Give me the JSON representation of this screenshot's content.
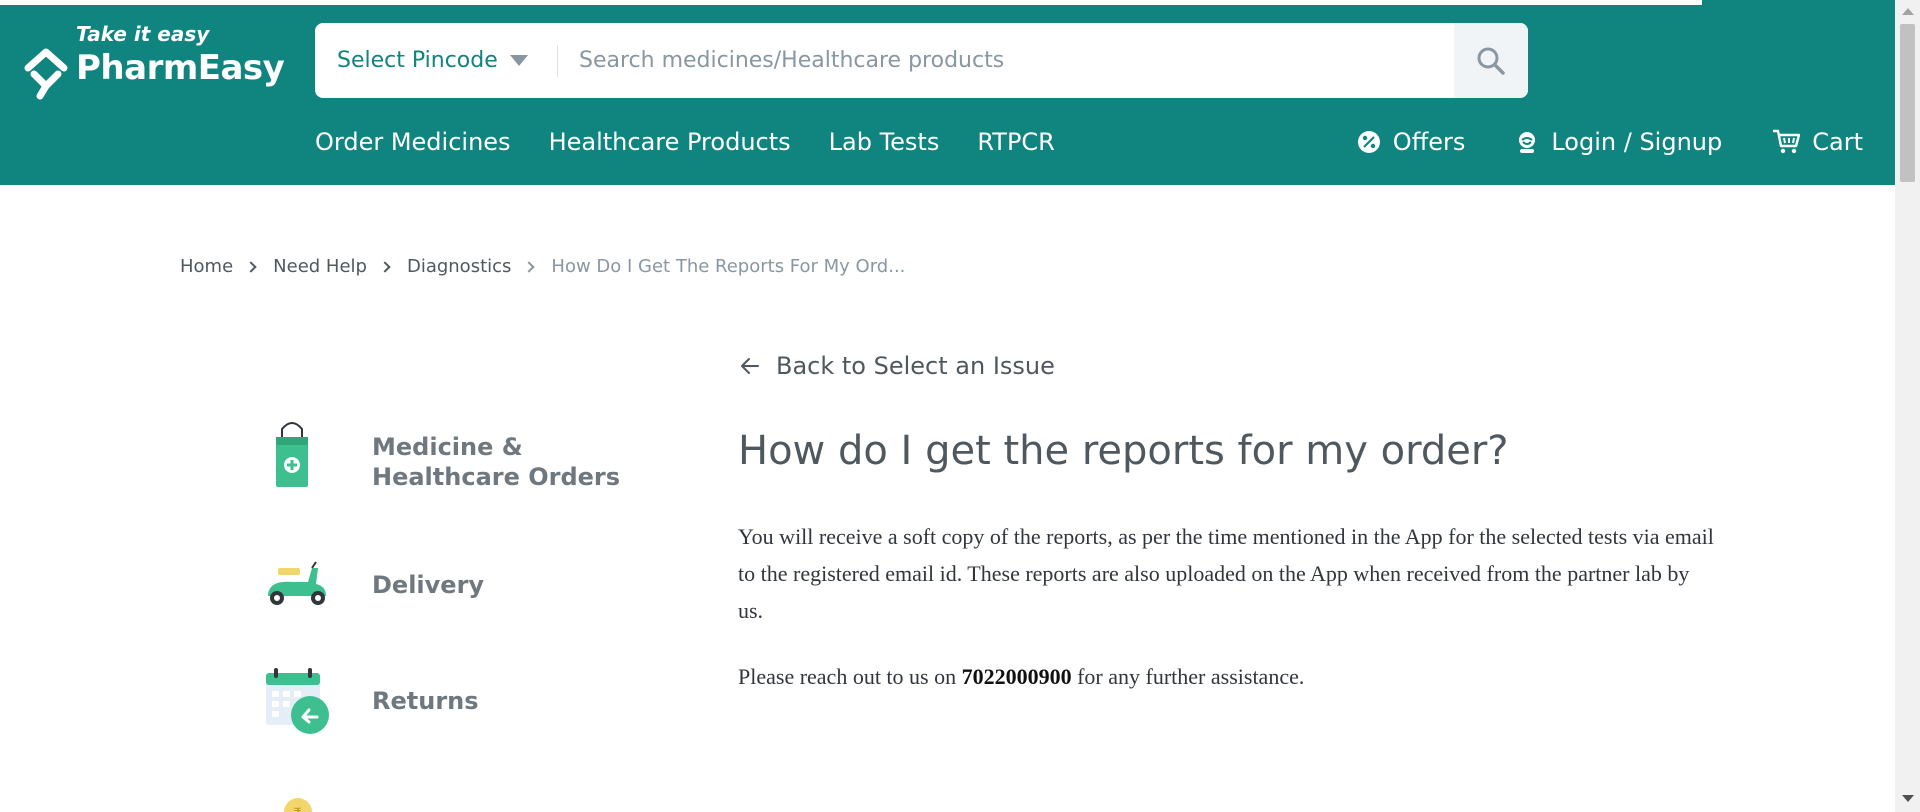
{
  "header": {
    "tagline": "Take it easy",
    "brand": "PharmEasy",
    "pincode_label": "Select Pincode",
    "search_placeholder": "Search medicines/Healthcare products",
    "nav": [
      "Order Medicines",
      "Healthcare Products",
      "Lab Tests",
      "RTPCR"
    ],
    "right_nav": {
      "offers": "Offers",
      "login": "Login / Signup",
      "cart": "Cart"
    }
  },
  "breadcrumb": {
    "home": "Home",
    "need_help": "Need Help",
    "diagnostics": "Diagnostics",
    "current": "How Do I Get The Reports For My Ord..."
  },
  "sidebar": {
    "items": [
      {
        "line1": "Medicine &",
        "line2": "Healthcare Orders",
        "icon": "shopping-bag-icon"
      },
      {
        "label": "Delivery",
        "icon": "scooter-icon"
      },
      {
        "label": "Returns",
        "icon": "calendar-return-icon"
      }
    ]
  },
  "content": {
    "back_link": "Back to Select an Issue",
    "title": "How do I get the reports for my order?",
    "body": "You will receive a soft copy of the reports, as per the time mentioned in the App for the selected tests via email to the registered email id. These reports are also uploaded on the App when received from the partner lab by us.",
    "contact_prefix": "Please reach out to us on ",
    "phone": "7022000900",
    "contact_suffix": " for any further assistance."
  },
  "colors": {
    "brand_teal": "#10847e",
    "text": "#4f585e",
    "muted": "#8897a2"
  }
}
